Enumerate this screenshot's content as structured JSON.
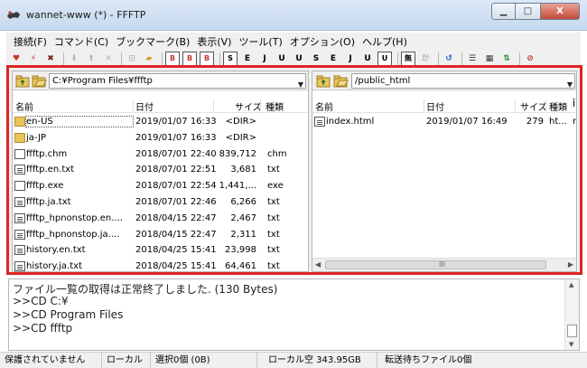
{
  "window": {
    "title": "wannet-www (*) - FFFTP",
    "min_glyph": "▁",
    "max_glyph": "□",
    "close_glyph": "X"
  },
  "menu": [
    "接続(F)",
    "コマンド(C)",
    "ブックマーク(B)",
    "表示(V)",
    "ツール(T)",
    "オプション(O)",
    "ヘルプ(H)"
  ],
  "toolbar": {
    "buttons": [
      {
        "icon": "connect-icon",
        "glyph": "♥",
        "color": "#c0392b"
      },
      {
        "icon": "quick-connect-icon",
        "glyph": "⚡",
        "color": "#c0392b"
      },
      {
        "icon": "disconnect-icon",
        "glyph": "✖",
        "color": "#7a1f1f"
      },
      {
        "icon": "download-icon",
        "glyph": "⬇",
        "color": "#b8b8b8"
      },
      {
        "icon": "upload-icon",
        "glyph": "⬆",
        "color": "#b8b8b8"
      },
      {
        "icon": "delete-icon",
        "glyph": "✕",
        "color": "#b8b8b8"
      },
      {
        "icon": "rename-icon",
        "glyph": "⊡",
        "color": "#b8b8b8"
      },
      {
        "icon": "mkdir-icon",
        "glyph": "▰",
        "color": "#d4a017"
      },
      {
        "icon": "mirror-up-icon",
        "glyph": "B",
        "color": "#c0392b",
        "boxed": true
      },
      {
        "icon": "mirror-down-icon",
        "glyph": "B",
        "color": "#c0392b",
        "boxed": true
      },
      {
        "icon": "binary-icon",
        "glyph": "B",
        "color": "#c0392b",
        "boxed": true
      },
      {
        "icon": "sjis-icon",
        "glyph": "S",
        "color": "#000",
        "boxed": true
      },
      {
        "icon": "euc-icon",
        "glyph": "E",
        "color": "#000"
      },
      {
        "icon": "jis-icon",
        "glyph": "J",
        "color": "#000"
      },
      {
        "icon": "utf8-icon",
        "glyph": "U",
        "color": "#000"
      },
      {
        "icon": "utf8-bom-icon",
        "glyph": "U",
        "color": "#000"
      },
      {
        "icon": "sjis2-icon",
        "glyph": "S",
        "color": "#000"
      },
      {
        "icon": "euc2-icon",
        "glyph": "E",
        "color": "#000"
      },
      {
        "icon": "jis2-icon",
        "glyph": "J",
        "color": "#000"
      },
      {
        "icon": "utf8-2-icon",
        "glyph": "U",
        "color": "#000"
      },
      {
        "icon": "utf8-bom-2-icon",
        "glyph": "U",
        "color": "#000",
        "boxed": true
      },
      {
        "icon": "kana-icon",
        "glyph": "無",
        "color": "#000",
        "boxed": true
      },
      {
        "icon": "kana-convert-icon",
        "glyph": "か",
        "color": "#b8b8b8"
      },
      {
        "icon": "refresh-icon",
        "glyph": "↺",
        "color": "#1f5fbf"
      },
      {
        "icon": "list-view-icon",
        "glyph": "☰",
        "color": "#333"
      },
      {
        "icon": "detail-view-icon",
        "glyph": "▦",
        "color": "#333"
      },
      {
        "icon": "sync-icon",
        "glyph": "⇅",
        "color": "#2a8a2a"
      },
      {
        "icon": "stop-icon",
        "glyph": "⊘",
        "color": "#c0392b"
      }
    ]
  },
  "local": {
    "path": "C:¥Program Files¥ffftp",
    "columns": {
      "name": "名前",
      "date": "日付",
      "size": "サイズ",
      "type": "種類"
    },
    "files": [
      {
        "name": "en-US",
        "date": "2019/01/07 16:33",
        "size": "<DIR>",
        "type": "",
        "kind": "folder"
      },
      {
        "name": "ja-JP",
        "date": "2019/01/07 16:33",
        "size": "<DIR>",
        "type": "",
        "kind": "folder"
      },
      {
        "name": "ffftp.chm",
        "date": "2018/07/01 22:40",
        "size": "839,712",
        "type": "chm",
        "kind": "file"
      },
      {
        "name": "ffftp.en.txt",
        "date": "2018/07/01 22:51",
        "size": "3,681",
        "type": "txt",
        "kind": "txt"
      },
      {
        "name": "ffftp.exe",
        "date": "2018/07/01 22:54",
        "size": "1,441,...",
        "type": "exe",
        "kind": "file"
      },
      {
        "name": "ffftp.ja.txt",
        "date": "2018/07/01 22:46",
        "size": "6,266",
        "type": "txt",
        "kind": "txt"
      },
      {
        "name": "ffftp_hpnonstop.en....",
        "date": "2018/04/15 22:47",
        "size": "2,467",
        "type": "txt",
        "kind": "txt"
      },
      {
        "name": "ffftp_hpnonstop.ja....",
        "date": "2018/04/15 22:47",
        "size": "2,311",
        "type": "txt",
        "kind": "txt"
      },
      {
        "name": "history.en.txt",
        "date": "2018/04/25 15:41",
        "size": "23,998",
        "type": "txt",
        "kind": "txt"
      },
      {
        "name": "history.ja.txt",
        "date": "2018/04/25 15:41",
        "size": "64,461",
        "type": "txt",
        "kind": "txt"
      }
    ]
  },
  "remote": {
    "path": "/public_html",
    "columns": {
      "name": "名前",
      "date": "日付",
      "size": "サイズ",
      "type": "種類",
      "extra": "Ī"
    },
    "files": [
      {
        "name": "index.html",
        "date": "2019/01/07 16:49",
        "size": "279",
        "type": "ht...",
        "extra": "r",
        "kind": "txt"
      }
    ],
    "scroll_grip": "III"
  },
  "log": [
    "ファイル一覧の取得は正常終了しました. (130 Bytes)",
    ">>CD C:¥",
    ">>CD Program Files",
    ">>CD ffftp"
  ],
  "status": {
    "security": "保護されていません",
    "local": "ローカル",
    "selection": "選択0個 (0B)",
    "free": "ローカル空 343.95GB",
    "queue": "転送待ちファイル0個"
  },
  "colors": {
    "highlight_frame": "#e02424",
    "folder": "#e8c55a"
  }
}
